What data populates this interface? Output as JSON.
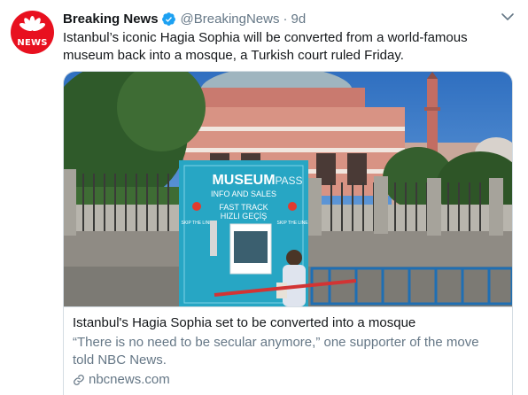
{
  "tweet": {
    "display_name": "Breaking News",
    "handle": "@BreakingNews",
    "separator": "·",
    "time": "9d",
    "text": "Istanbul’s iconic Hagia Sophia will be converted from a world-famous museum back into a mosque, a Turkish court ruled Friday.",
    "avatar_label": "NEWS",
    "icons": {
      "verified": "verified-badge-icon",
      "caret": "chevron-down-icon",
      "link": "link-icon"
    }
  },
  "card": {
    "image_signage": {
      "brand": "MUSEUM",
      "brand_suffix": "PASS",
      "subtitle": "INFO AND SALES",
      "fast_track": "FAST TRACK",
      "fast_track_tr": "HIZLI GEÇİŞ",
      "skip_left": "SKIP THE LINE",
      "skip_right": "SKIP THE LINE"
    },
    "title": "Istanbul's Hagia Sophia set to be converted into a mosque",
    "description": "“There is no need to be secular anymore,” one supporter of the move told NBC News.",
    "domain": "nbcnews.com"
  },
  "colors": {
    "brand_red": "#e8101f",
    "verified_blue": "#1da1f2",
    "muted_text": "#657786",
    "kiosk_teal": "#27a6c4"
  }
}
